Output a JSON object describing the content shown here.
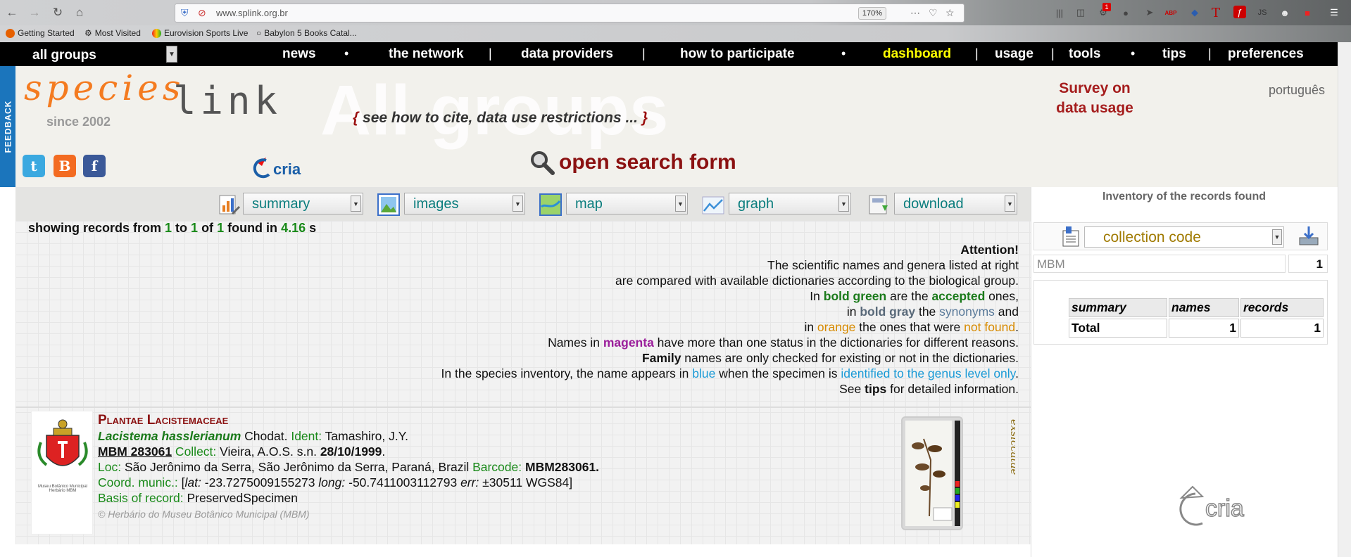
{
  "browser": {
    "url": "www.splink.org.br",
    "zoom": "170%",
    "bookmarks": [
      "Getting Started",
      "Most Visited",
      "Eurovision Sports Live",
      "Babylon 5 Books Catal..."
    ],
    "extension_badge": "1",
    "ext_labels": {
      "abp": "ABP",
      "t": "T",
      "js": "JS"
    }
  },
  "site_nav": {
    "group_select": "all groups",
    "items": [
      "news",
      "the network",
      "data providers",
      "how to participate",
      "dashboard",
      "usage",
      "tools",
      "tips",
      "preferences"
    ],
    "separators": [
      "•",
      "|",
      "|",
      "•",
      "|",
      "|",
      "•",
      "|"
    ],
    "active_color": "#ffff00"
  },
  "header": {
    "feedback": "FEEDBACK",
    "logo_species": "species",
    "logo_link": "link",
    "since": "since 2002",
    "background_title": "All groups",
    "cite_open": "{",
    "cite_text": " see how to cite, data use restrictions ... ",
    "cite_close": "}",
    "survey": "Survey on data usage",
    "language": "português",
    "search_form": "open search form",
    "cria_logo_text": "cria",
    "social": [
      "t",
      "B",
      "f"
    ]
  },
  "tools": {
    "items": [
      {
        "label": "summary",
        "icon": "summary-icon"
      },
      {
        "label": "images",
        "icon": "images-icon"
      },
      {
        "label": "map",
        "icon": "map-icon"
      },
      {
        "label": "graph",
        "icon": "graph-icon"
      },
      {
        "label": "download",
        "icon": "download-icon"
      }
    ],
    "dropdown_glyph": "▼"
  },
  "results": {
    "p1": "showing records from ",
    "from": "1",
    "p2": " to ",
    "to": "1",
    "p3": " of ",
    "total": "1",
    "p4": " found in ",
    "time": "4.16",
    "p5": " s"
  },
  "attention": {
    "title": "Attention!",
    "l1": "The scientific names and genera listed at right",
    "l2": "are compared with available dictionaries according to the biological group.",
    "l3a": "In ",
    "l3b": "bold green",
    "l3c": " are the ",
    "l3d": "accepted",
    "l3e": " ones,",
    "l4a": "in ",
    "l4b": "bold gray",
    "l4c": " the ",
    "l4d": "synonyms",
    "l4e": " and",
    "l5a": "in ",
    "l5b": "orange",
    "l5c": " the ones that were ",
    "l5d": "not found",
    "l5e": ".",
    "l6a": "Names in ",
    "l6b": "magenta",
    "l6c": " have more than one status in the dictionaries for different reasons.",
    "l7a": "Family",
    "l7b": " names are only checked for existing or not in the dictionaries.",
    "l8a": "In the species inventory, the name appears in ",
    "l8b": "blue",
    "l8c": " when the specimen is ",
    "l8d": "identified to the genus level only",
    "l8e": ".",
    "l9a": "See ",
    "l9b": "tips",
    "l9c": " for detailed information."
  },
  "record": {
    "family": "Plantae Lacistemaceae",
    "species": "Lacistema hasslerianum",
    "author": " Chodat. ",
    "ident_label": "Ident:",
    "ident": " Tamashiro, J.Y.",
    "catalog": "MBM 283061",
    "collect_label": " Collect:",
    "collector": " Vieira, A.O.S. s.n. ",
    "date": "28/10/1999",
    "date_end": ".",
    "loc_label": "Loc:",
    "locality": " São Jerônimo da Serra, São Jerônimo da Serra, Paraná, Brazil ",
    "barcode_label": "Barcode:",
    "barcode": " MBM283061.",
    "coord_label": "Coord. munic.:",
    "coord_open": " [",
    "lat_label": "lat:",
    "lat": " -23.7275009155273 ",
    "long_label": "long:",
    "long": " -50.7411003112793 ",
    "err_label": "err:",
    "err": " ±30511 WGS84]",
    "basis_label": "Basis of record:",
    "basis": " PreservedSpecimen",
    "copyright": "© Herbário do Museu Botânico Municipal (MBM)",
    "exsiccatae": "exsiccatae",
    "coat_caption": "Museu Botânico Municipal Herbário MBM"
  },
  "inventory": {
    "title": "Inventory of the records found",
    "select": "collection code",
    "item_name": "MBM",
    "item_count": "1",
    "headers": [
      "summary",
      "names",
      "records"
    ],
    "total_label": "Total",
    "total_names": "1",
    "total_records": "1",
    "cria_text": "cria"
  }
}
